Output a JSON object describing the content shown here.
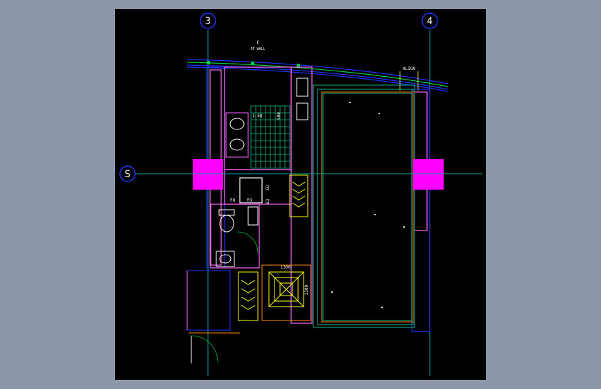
{
  "drawing": {
    "grid_marks": {
      "left": "3",
      "right": "4",
      "side": "S"
    },
    "wall_note": {
      "symbol": "£",
      "text": "OF WALL"
    },
    "align_note": "ALIGN",
    "dims": {
      "eq1": "1  EQ",
      "dim_500": "500",
      "eq_vert": "EQ",
      "eq_a": "EQ",
      "eq_b": "EQ",
      "eq_c": "EQ",
      "dim_1300_h": "1300",
      "dim_1300_v": "1300"
    },
    "colors": {
      "background": "#000000",
      "frame": "#8b96a8",
      "grid": "#00a0a0",
      "wall": "#2222ff",
      "column": "#ff00ff",
      "partition": "#ff66ff",
      "fixture": "#ffff00",
      "tile": "#00bb88",
      "bed_edge": "#ff8800",
      "text": "#ffffff"
    }
  }
}
